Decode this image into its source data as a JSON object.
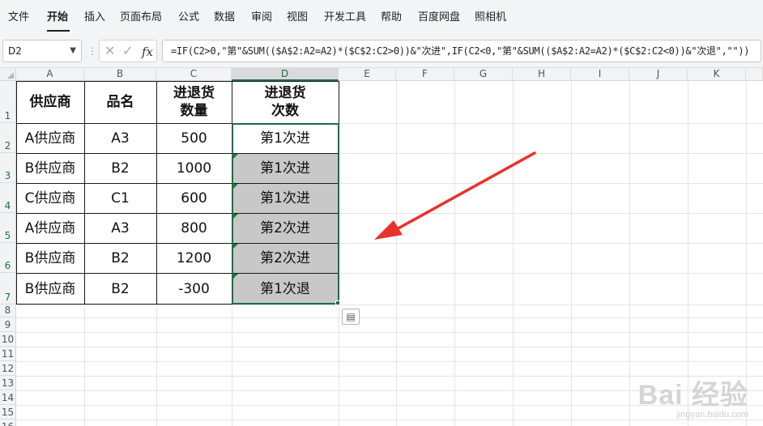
{
  "menu": {
    "items": [
      "文件",
      "开始",
      "插入",
      "页面布局",
      "公式",
      "数据",
      "审阅",
      "视图",
      "开发工具",
      "帮助",
      "百度网盘",
      "照相机"
    ],
    "active_index": 1
  },
  "formula_bar": {
    "name_box": "D2",
    "separator": "⋮",
    "cancel_glyph": "✕",
    "confirm_glyph": "✓",
    "fx_label": "fx",
    "formula": "=IF(C2>0,\"第\"&SUM(($A$2:A2=A2)*($C$2:C2>0))&\"次进\",IF(C2<0,\"第\"&SUM(($A$2:A2=A2)*($C$2:C2<0))&\"次退\",\"\"))"
  },
  "grid": {
    "columns": [
      "A",
      "B",
      "C",
      "D",
      "E",
      "F",
      "G",
      "H",
      "I",
      "J",
      "K"
    ],
    "selected_column": "D",
    "rows": [
      "1",
      "2",
      "3",
      "4",
      "5",
      "6",
      "7",
      "8",
      "9",
      "10",
      "11",
      "12",
      "13",
      "14",
      "15",
      "16"
    ]
  },
  "table": {
    "headers": [
      "供应商",
      "品名",
      "进退货\n数量",
      "进退货\n次数"
    ],
    "rows": [
      [
        "A供应商",
        "A3",
        "500",
        "第1次进"
      ],
      [
        "B供应商",
        "B2",
        "1000",
        "第1次进"
      ],
      [
        "C供应商",
        "C1",
        "600",
        "第1次进"
      ],
      [
        "A供应商",
        "A3",
        "800",
        "第2次进"
      ],
      [
        "B供应商",
        "B2",
        "1200",
        "第2次进"
      ],
      [
        "B供应商",
        "B2",
        "-300",
        "第1次退"
      ]
    ]
  },
  "colors": {
    "selection": "#1f6e43",
    "shaded_cell": "#c8c8c8",
    "arrow": "#e8322b"
  },
  "watermark": {
    "logo": "Bai 经验",
    "url": "jingyan.baidu.com"
  }
}
